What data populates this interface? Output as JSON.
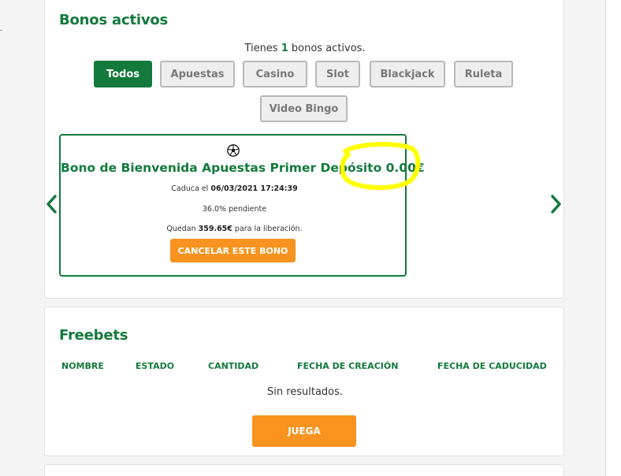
{
  "bonos": {
    "title": "Bonos activos",
    "summary_prefix": "Tienes ",
    "summary_count": "1",
    "summary_suffix": " bonos activos.",
    "filters": [
      "Todos",
      "Apuestas",
      "Casino",
      "Slot",
      "Blackjack",
      "Ruleta",
      "Video Bingo"
    ],
    "active_filter": "Todos",
    "card": {
      "icon": "soccer-ball-icon",
      "title": "Bono de Bienvenida Apuestas Primer Depósito 0.00€",
      "expiry_prefix": "Caduca el ",
      "expiry_value": "06/03/2021 17:24:39",
      "pending": "36.0% pendiente",
      "remaining_prefix": "Quedan ",
      "remaining_value": "359.65€",
      "remaining_suffix": " para la liberación.",
      "cancel_label": "CANCELAR ESTE BONO"
    },
    "highlight_color": "#ffff00"
  },
  "freebets": {
    "title": "Freebets",
    "columns": [
      "NOMBRE",
      "ESTADO",
      "CANTIDAD",
      "FECHA DE CREACIÓN",
      "FECHA DE CADUCIDAD"
    ],
    "empty_text": "Sin resultados.",
    "play_label": "JUEGA"
  },
  "colors": {
    "brand_green": "#137a3c",
    "accent_orange": "#f7931e"
  }
}
